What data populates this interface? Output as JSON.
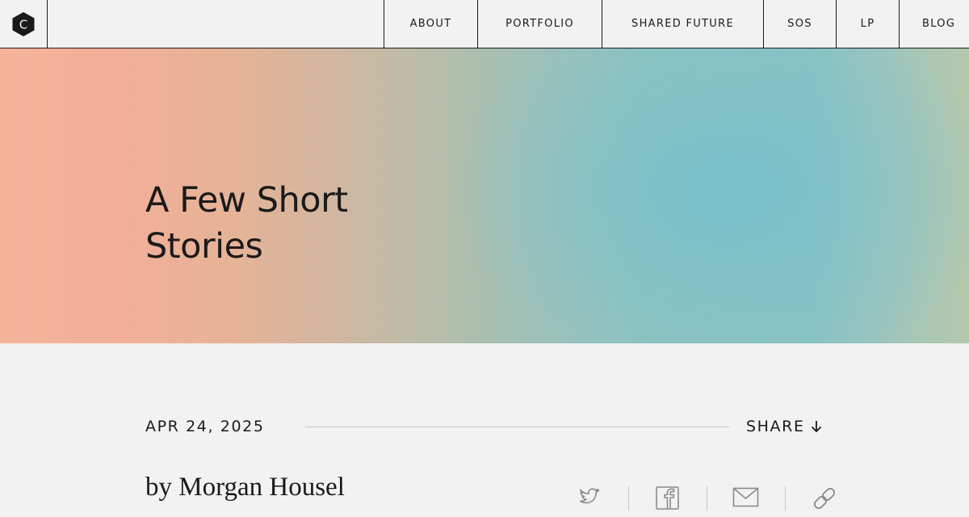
{
  "nav": {
    "logo_letter": "C",
    "items": [
      {
        "label": "ABOUT"
      },
      {
        "label": "PORTFOLIO"
      },
      {
        "label": "SHARED FUTURE"
      },
      {
        "label": "SOS"
      },
      {
        "label": "LP"
      },
      {
        "label": "BLOG"
      }
    ]
  },
  "hero": {
    "title_line1": "A Few Short",
    "title_line2": "Stories"
  },
  "meta": {
    "date": "APR 24, 2025",
    "share_label": "SHARE"
  },
  "author": {
    "byline": "by Morgan Housel"
  },
  "share_icons": [
    "twitter-icon",
    "facebook-icon",
    "email-icon",
    "link-icon"
  ],
  "colors": {
    "text": "#1a1a1a",
    "background": "#f2f2f2",
    "gradient_peach": "#f5b49a",
    "gradient_teal": "#79c1cc",
    "icon_gray": "#8a8a8a",
    "rule_gray": "#c6c6c6"
  }
}
